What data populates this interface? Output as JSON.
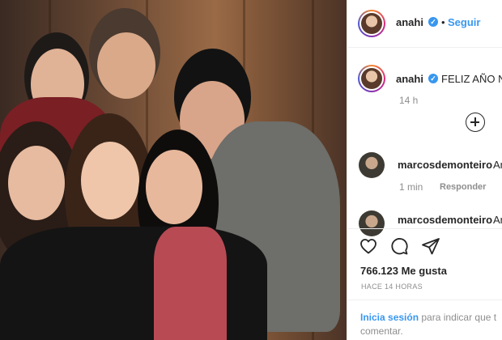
{
  "photo": {
    "alt": "Group photo"
  },
  "header": {
    "username": "anahi",
    "verified_symbol": "✓",
    "separator": "•",
    "follow_label": "Seguir"
  },
  "caption": {
    "username": "anahi",
    "text": "FELIZ AÑO N",
    "time": "14 h"
  },
  "comments": [
    {
      "username": "marcosdemonteiro",
      "text": "Ar",
      "time": "1 min",
      "reply_label": "Responder"
    },
    {
      "username": "marcosdemonteiro",
      "text": "Ar"
    }
  ],
  "actions": {
    "likes": "766.123 Me gusta",
    "posted_ago": "HACE 14 HORAS"
  },
  "footer": {
    "login_link": "Inicia sesión",
    "login_text": "para indicar que t",
    "login_text2": "comentar."
  },
  "colors": {
    "link": "#3897f0",
    "muted": "#8e8e8e",
    "text": "#262626"
  },
  "icons": [
    "heart-icon",
    "comment-icon",
    "share-icon",
    "plus-circle-icon",
    "verified-badge-icon"
  ]
}
